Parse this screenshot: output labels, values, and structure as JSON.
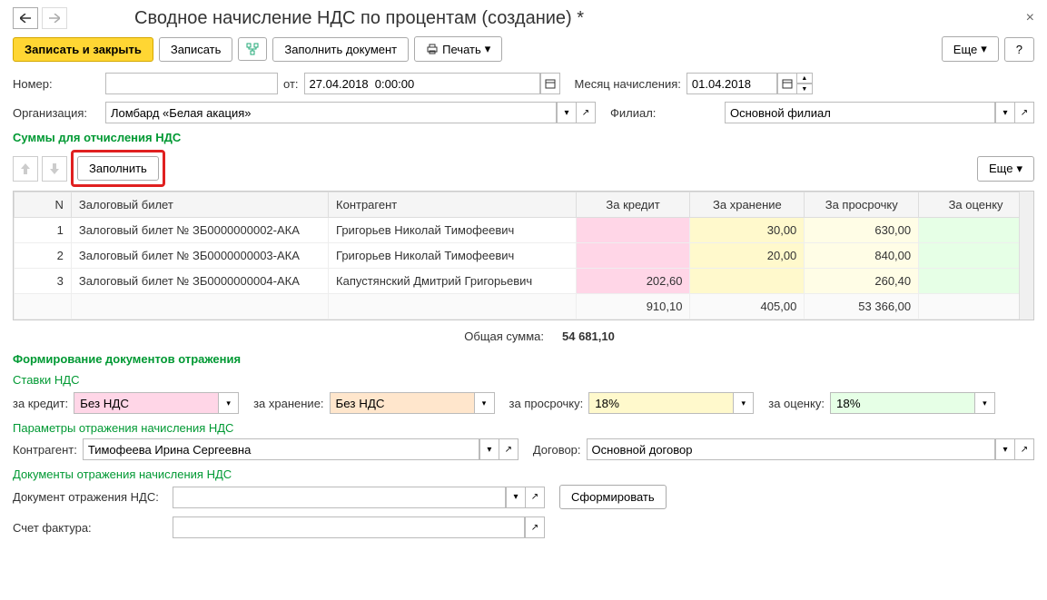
{
  "header": {
    "title": "Сводное начисление НДС по процентам (создание) *"
  },
  "toolbar": {
    "save_close": "Записать и закрыть",
    "save": "Записать",
    "fill_doc": "Заполнить документ",
    "print": "Печать",
    "more": "Еще",
    "help": "?"
  },
  "form": {
    "number_label": "Номер:",
    "number_value": "",
    "from_label": "от:",
    "from_value": "27.04.2018  0:00:00",
    "month_label": "Месяц начисления:",
    "month_value": "01.04.2018",
    "org_label": "Организация:",
    "org_value": "Ломбард «Белая акация»",
    "branch_label": "Филиал:",
    "branch_value": "Основной филиал"
  },
  "section1": {
    "title": "Суммы для отчисления НДС",
    "fill_btn": "Заполнить",
    "more": "Еще",
    "columns": {
      "n": "N",
      "ticket": "Залоговый билет",
      "contragent": "Контрагент",
      "credit": "За кредит",
      "store": "За хранение",
      "overdue": "За просрочку",
      "eval": "За оценку"
    },
    "rows": [
      {
        "n": "1",
        "ticket": "Залоговый билет № ЗБ0000000002-АКА",
        "contragent": "Григорьев Николай Тимофеевич",
        "credit": "",
        "store": "30,00",
        "overdue": "630,00",
        "eval": ""
      },
      {
        "n": "2",
        "ticket": "Залоговый билет № ЗБ0000000003-АКА",
        "contragent": "Григорьев Николай Тимофеевич",
        "credit": "",
        "store": "20,00",
        "overdue": "840,00",
        "eval": ""
      },
      {
        "n": "3",
        "ticket": "Залоговый билет № ЗБ0000000004-АКА",
        "contragent": "Капустянский Дмитрий Григорьевич",
        "credit": "202,60",
        "store": "",
        "overdue": "260,40",
        "eval": ""
      }
    ],
    "footer": {
      "credit": "910,10",
      "store": "405,00",
      "overdue": "53 366,00",
      "eval": ""
    },
    "total_label": "Общая сумма:",
    "total_value": "54 681,10"
  },
  "section2": {
    "title": "Формирование документов отражения",
    "rates_title": "Ставки НДС",
    "rates": {
      "credit_label": "за кредит:",
      "credit_value": "Без НДС",
      "store_label": "за хранение:",
      "store_value": "Без НДС",
      "overdue_label": "за просрочку:",
      "overdue_value": "18%",
      "eval_label": "за оценку:",
      "eval_value": "18%"
    },
    "params_title": "Параметры отражения начисления НДС",
    "contragent_label": "Контрагент:",
    "contragent_value": "Тимофеева Ирина Сергеевна",
    "contract_label": "Договор:",
    "contract_value": "Основной договор",
    "docs_title": "Документы отражения начисления НДС",
    "doc_label": "Документ отражения НДС:",
    "doc_value": "",
    "form_btn": "Сформировать",
    "invoice_label": "Счет фактура:",
    "invoice_value": ""
  }
}
